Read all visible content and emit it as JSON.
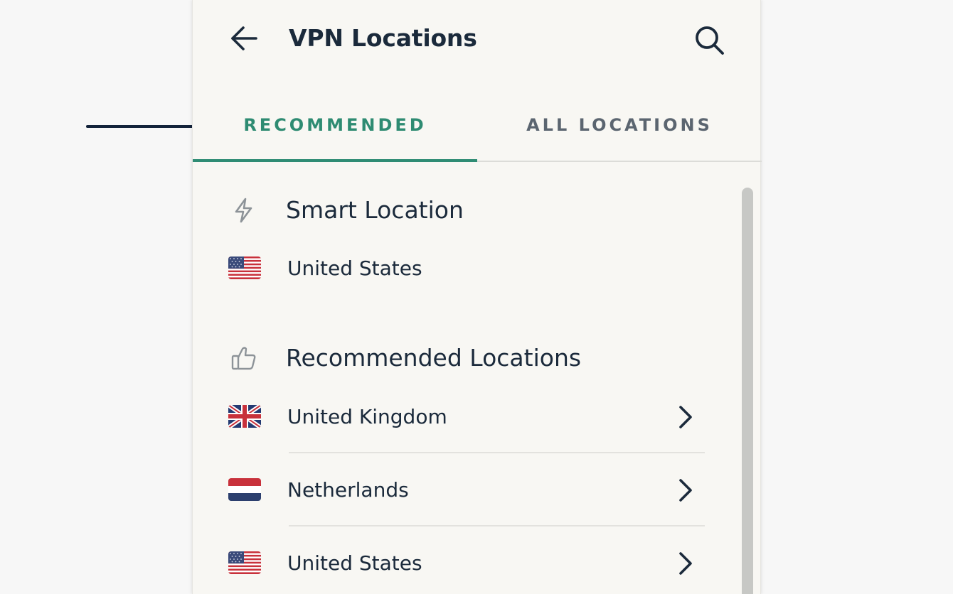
{
  "header": {
    "title": "VPN Locations",
    "back_icon": "arrow-left-icon",
    "search_icon": "search-icon"
  },
  "tabs": [
    {
      "label": "RECOMMENDED",
      "selected": true
    },
    {
      "label": "ALL LOCATIONS",
      "selected": false
    }
  ],
  "smart_location": {
    "heading": "Smart Location",
    "icon": "lightning-icon",
    "country": "United States",
    "flag": "us-flag-icon"
  },
  "recommended": {
    "heading": "Recommended Locations",
    "icon": "thumbs-up-icon",
    "items": [
      {
        "country": "United Kingdom",
        "flag": "uk-flag-icon"
      },
      {
        "country": "Netherlands",
        "flag": "nl-flag-icon"
      },
      {
        "country": "United States",
        "flag": "us-flag-icon"
      }
    ]
  },
  "colors": {
    "accent": "#2f8c74",
    "text": "#1b2a3b",
    "muted_tab": "#5b6570",
    "panel_bg": "#f8f7f3"
  }
}
